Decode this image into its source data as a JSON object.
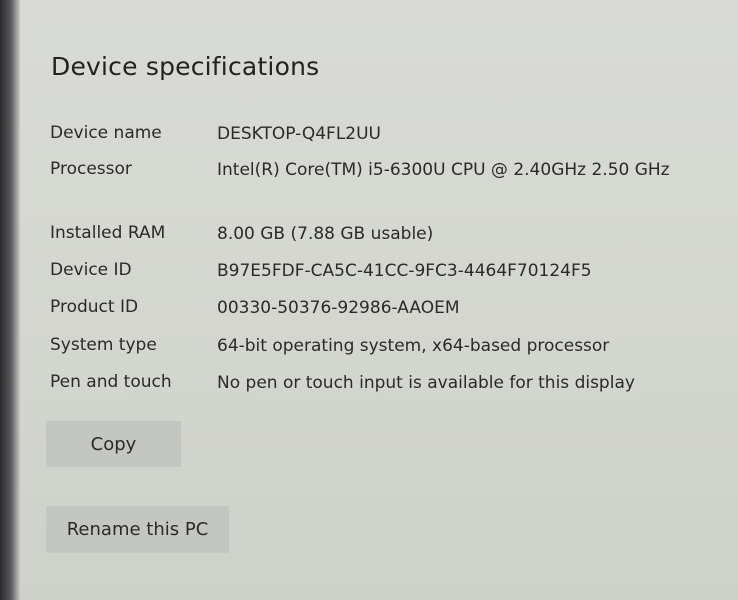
{
  "title": "Device specifications",
  "specs": [
    {
      "label": "Device name",
      "value": "DESKTOP-Q4FL2UU"
    },
    {
      "label": "Processor",
      "value": "Intel(R) Core(TM) i5-6300U CPU @ 2.40GHz   2.50 GHz"
    },
    {
      "label": "Installed RAM",
      "value": "8.00 GB (7.88 GB usable)"
    },
    {
      "label": "Device ID",
      "value": "B97E5FDF-CA5C-41CC-9FC3-4464F70124F5"
    },
    {
      "label": "Product ID",
      "value": "00330-50376-92986-AAOEM"
    },
    {
      "label": "System type",
      "value": "64-bit operating system, x64-based processor"
    },
    {
      "label": "Pen and touch",
      "value": "No pen or touch input is available for this display"
    }
  ],
  "buttons": {
    "copy_label": "Copy",
    "rename_label": "Rename this PC"
  }
}
